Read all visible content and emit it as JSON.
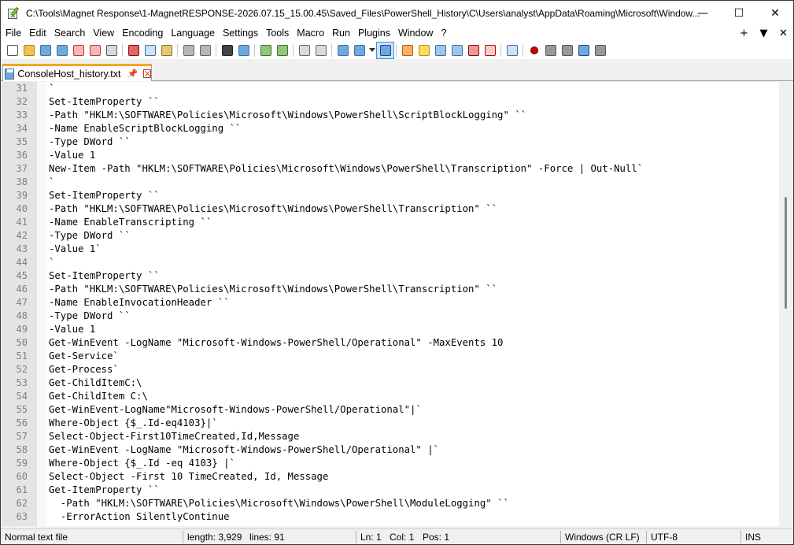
{
  "window": {
    "title": "C:\\Tools\\Magnet Response\\1-MagnetRESPONSE-2026.07.15_15.00.45\\Saved_Files\\PowerShell_History\\C\\Users\\analyst\\AppData\\Roaming\\Microsoft\\Window...",
    "minimize": "—",
    "maximize": "☐",
    "close": "✕"
  },
  "menu": {
    "items": [
      "File",
      "Edit",
      "Search",
      "View",
      "Encoding",
      "Language",
      "Settings",
      "Tools",
      "Macro",
      "Run",
      "Plugins",
      "Window",
      "?"
    ],
    "right": [
      "+",
      "▼",
      "✕"
    ]
  },
  "toolbar": {
    "icons": [
      {
        "name": "new-file-icon",
        "color": "#ffffff",
        "border": "#555555"
      },
      {
        "name": "open-file-icon",
        "color": "#f2c14e",
        "border": "#b07d10"
      },
      {
        "name": "save-icon",
        "color": "#6fa8dc",
        "border": "#3a6ea5"
      },
      {
        "name": "save-all-icon",
        "color": "#6fa8dc",
        "border": "#3a6ea5"
      },
      {
        "name": "close-file-icon",
        "color": "#f4b6b6",
        "border": "#c0392b"
      },
      {
        "name": "close-all-icon",
        "color": "#f4b6b6",
        "border": "#c0392b"
      },
      {
        "name": "print-icon",
        "color": "#d9d9d9",
        "border": "#555555"
      },
      {
        "name": "sep"
      },
      {
        "name": "cut-icon",
        "color": "#e06666",
        "border": "#990000"
      },
      {
        "name": "copy-icon",
        "color": "#cfe2f3",
        "border": "#3a6ea5"
      },
      {
        "name": "paste-icon",
        "color": "#e6c77a",
        "border": "#8a6d1e"
      },
      {
        "name": "sep"
      },
      {
        "name": "undo-icon",
        "color": "#b7b7b7",
        "border": "#666666"
      },
      {
        "name": "redo-icon",
        "color": "#b7b7b7",
        "border": "#666666"
      },
      {
        "name": "sep"
      },
      {
        "name": "find-icon",
        "color": "#444444",
        "border": "#222222"
      },
      {
        "name": "replace-icon",
        "color": "#6fa8dc",
        "border": "#3a6ea5"
      },
      {
        "name": "sep"
      },
      {
        "name": "zoom-in-icon",
        "color": "#93c47d",
        "border": "#38761d"
      },
      {
        "name": "zoom-out-icon",
        "color": "#93c47d",
        "border": "#38761d"
      },
      {
        "name": "sep"
      },
      {
        "name": "sync-vertical-icon",
        "color": "#d9d9d9",
        "border": "#666666"
      },
      {
        "name": "sync-horizontal-icon",
        "color": "#d9d9d9",
        "border": "#666666"
      },
      {
        "name": "sep"
      },
      {
        "name": "word-wrap-icon",
        "color": "#6fa8dc",
        "border": "#3a6ea5"
      },
      {
        "name": "show-all-chars-icon",
        "color": "#6fa8dc",
        "border": "#3a6ea5"
      },
      {
        "name": "dropdown-arrow-icon",
        "color": "#333333",
        "border": "#333333"
      },
      {
        "name": "indent-guide-icon",
        "color": "#6fa8dc",
        "border": "#1c4587",
        "active": true
      },
      {
        "name": "sep"
      },
      {
        "name": "udl-icon",
        "color": "#f6b26b",
        "border": "#b45f06"
      },
      {
        "name": "doc-map-icon",
        "color": "#ffd966",
        "border": "#bf9000"
      },
      {
        "name": "doc-list-icon",
        "color": "#9fc5e8",
        "border": "#3a6ea5"
      },
      {
        "name": "function-list-icon",
        "color": "#9fc5e8",
        "border": "#3a6ea5"
      },
      {
        "name": "folder-workspace-icon",
        "color": "#ea9999",
        "border": "#990000"
      },
      {
        "name": "panel-icon",
        "color": "#f4cccc",
        "border": "#cc0000"
      },
      {
        "name": "sep"
      },
      {
        "name": "monitoring-eye-icon",
        "color": "#cfe2f3",
        "border": "#3a6ea5"
      },
      {
        "name": "sep"
      },
      {
        "name": "record-macro-icon",
        "color": "#cc0000",
        "border": "#660000"
      },
      {
        "name": "stop-macro-icon",
        "color": "#999999",
        "border": "#555555"
      },
      {
        "name": "play-macro-icon",
        "color": "#999999",
        "border": "#555555"
      },
      {
        "name": "run-macro-multiple-icon",
        "color": "#6fa8dc",
        "border": "#1c4587"
      },
      {
        "name": "save-macro-icon",
        "color": "#999999",
        "border": "#555555"
      }
    ]
  },
  "tab": {
    "label": "ConsoleHost_history.txt",
    "pin": "📌"
  },
  "editor": {
    "lines": [
      {
        "n": "31",
        "text": "`"
      },
      {
        "n": "32",
        "text": "Set-ItemProperty ``"
      },
      {
        "n": "33",
        "text": "-Path \"HKLM:\\SOFTWARE\\Policies\\Microsoft\\Windows\\PowerShell\\ScriptBlockLogging\" ``"
      },
      {
        "n": "34",
        "text": "-Name EnableScriptBlockLogging ``"
      },
      {
        "n": "35",
        "text": "-Type DWord ``"
      },
      {
        "n": "36",
        "text": "-Value 1"
      },
      {
        "n": "37",
        "text": "New-Item -Path \"HKLM:\\SOFTWARE\\Policies\\Microsoft\\Windows\\PowerShell\\Transcription\" -Force | Out-Null`"
      },
      {
        "n": "38",
        "text": "`"
      },
      {
        "n": "39",
        "text": "Set-ItemProperty ``"
      },
      {
        "n": "40",
        "text": "-Path \"HKLM:\\SOFTWARE\\Policies\\Microsoft\\Windows\\PowerShell\\Transcription\" ``"
      },
      {
        "n": "41",
        "text": "-Name EnableTranscripting ``"
      },
      {
        "n": "42",
        "text": "-Type DWord ``"
      },
      {
        "n": "43",
        "text": "-Value 1`"
      },
      {
        "n": "44",
        "text": "`"
      },
      {
        "n": "45",
        "text": "Set-ItemProperty ``"
      },
      {
        "n": "46",
        "text": "-Path \"HKLM:\\SOFTWARE\\Policies\\Microsoft\\Windows\\PowerShell\\Transcription\" ``"
      },
      {
        "n": "47",
        "text": "-Name EnableInvocationHeader ``"
      },
      {
        "n": "48",
        "text": "-Type DWord ``"
      },
      {
        "n": "49",
        "text": "-Value 1"
      },
      {
        "n": "50",
        "text": "Get-WinEvent -LogName \"Microsoft-Windows-PowerShell/Operational\" -MaxEvents 10"
      },
      {
        "n": "51",
        "text": "Get-Service`"
      },
      {
        "n": "52",
        "text": "Get-Process`"
      },
      {
        "n": "53",
        "text": "Get-ChildItemC:\\"
      },
      {
        "n": "54",
        "text": "Get-ChildItem C:\\"
      },
      {
        "n": "55",
        "text": "Get-WinEvent-LogName\"Microsoft-Windows-PowerShell/Operational\"|`"
      },
      {
        "n": "56",
        "text": "Where-Object {$_.Id-eq4103}|`"
      },
      {
        "n": "57",
        "text": "Select-Object-First10TimeCreated,Id,Message"
      },
      {
        "n": "58",
        "text": "Get-WinEvent -LogName \"Microsoft-Windows-PowerShell/Operational\" |`"
      },
      {
        "n": "59",
        "text": "Where-Object {$_.Id -eq 4103} |`"
      },
      {
        "n": "60",
        "text": "Select-Object -First 10 TimeCreated, Id, Message"
      },
      {
        "n": "61",
        "text": "Get-ItemProperty ``"
      },
      {
        "n": "62",
        "text": "  -Path \"HKLM:\\SOFTWARE\\Policies\\Microsoft\\Windows\\PowerShell\\ModuleLogging\" ``"
      },
      {
        "n": "63",
        "text": "  -ErrorAction SilentlyContinue"
      }
    ]
  },
  "status": {
    "file_type": "Normal text file",
    "length": "length: 3,929",
    "lines": "lines: 91",
    "ln": "Ln: 1",
    "col": "Col: 1",
    "pos": "Pos: 1",
    "eol": "Windows (CR LF)",
    "encoding": "UTF-8",
    "mode": "INS"
  }
}
